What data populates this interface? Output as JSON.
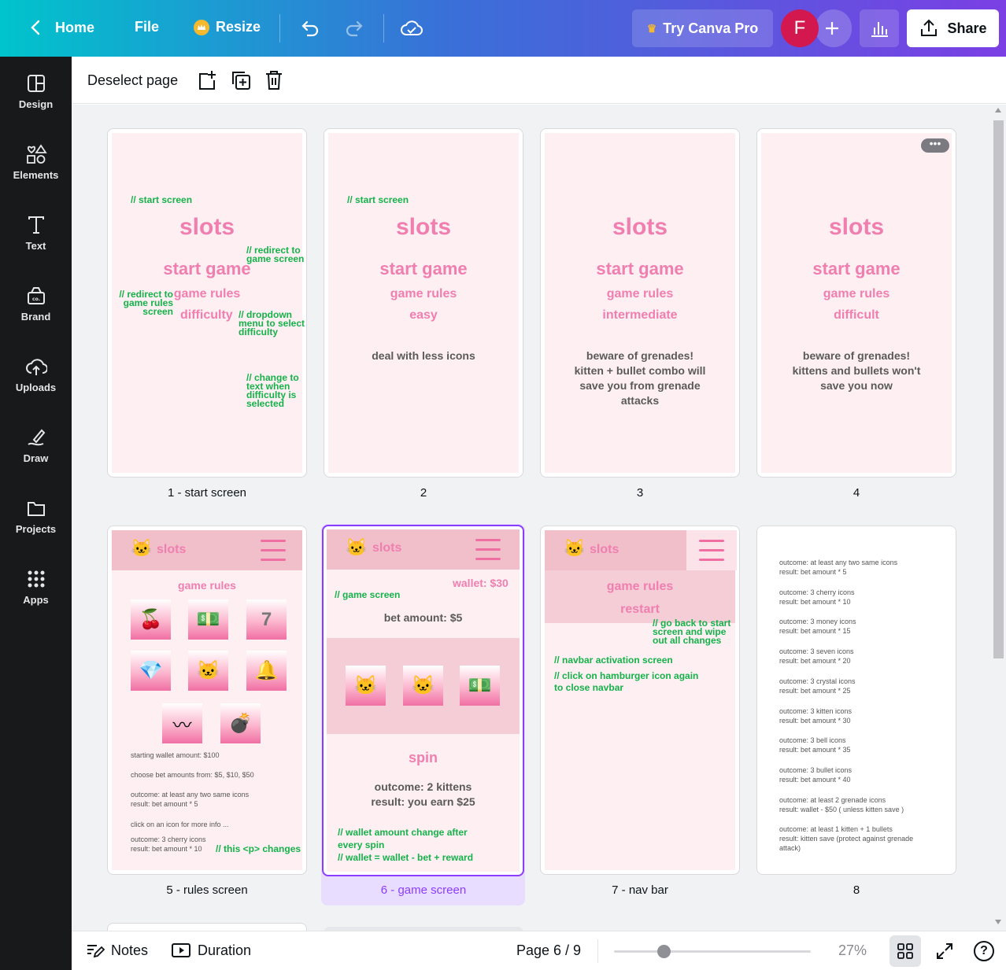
{
  "topbar": {
    "home": "Home",
    "file": "File",
    "resize": "Resize",
    "try_pro": "Try Canva Pro",
    "avatar": "F",
    "share": "Share"
  },
  "sidebar": {
    "items": [
      {
        "label": "Design",
        "icon": "design-icon"
      },
      {
        "label": "Elements",
        "icon": "elements-icon"
      },
      {
        "label": "Text",
        "icon": "text-icon"
      },
      {
        "label": "Brand",
        "icon": "brand-icon"
      },
      {
        "label": "Uploads",
        "icon": "uploads-icon"
      },
      {
        "label": "Draw",
        "icon": "draw-icon"
      },
      {
        "label": "Projects",
        "icon": "projects-icon"
      },
      {
        "label": "Apps",
        "icon": "apps-icon"
      }
    ]
  },
  "toolbar": {
    "deselect": "Deselect page"
  },
  "pages": {
    "p1": {
      "label": "1 - start screen",
      "c1": "// start screen",
      "title": "slots",
      "start": "start game",
      "rules": "game rules",
      "difficulty": "difficulty",
      "c2": "// redirect to game screen",
      "c3": "// redirect to game rules screen",
      "c4": "// dropdown menu to select difficulty",
      "c5": "// change to text when difficulty is selected"
    },
    "p2": {
      "label": "2",
      "c1": "// start screen",
      "title": "slots",
      "start": "start game",
      "rules": "game rules",
      "difficulty": "easy",
      "desc": "deal with less icons"
    },
    "p3": {
      "label": "3",
      "title": "slots",
      "start": "start game",
      "rules": "game rules",
      "difficulty": "intermediate",
      "desc1": "beware of grenades!",
      "desc2": "kitten + bullet combo will",
      "desc3": "save you from grenade",
      "desc4": "attacks"
    },
    "p4": {
      "label": "4",
      "title": "slots",
      "start": "start game",
      "rules": "game rules",
      "difficulty": "difficult",
      "desc1": "beware of grenades!",
      "desc2": "kittens and bullets won't",
      "desc3": "save you now"
    },
    "p5": {
      "label": "5 - rules screen",
      "brand": "slots",
      "heading": "game rules",
      "t1": "starting wallet amount: $100",
      "t2": "choose bet amounts from: $5, $10, $50",
      "t3a": "outcome: at least any two same icons",
      "t3b": "result: bet amount * 5",
      "t4": "click on an icon for more info ...",
      "t5a": "outcome: 3 cherry icons",
      "t5b": "result: bet amount * 10",
      "c1": "// this <p> changes"
    },
    "p6": {
      "label": "6 - game screen",
      "brand": "slots",
      "wallet": "wallet: $30",
      "c1": "// game screen",
      "bet": "bet amount: $5",
      "spin": "spin",
      "outcome": "outcome: 2 kittens",
      "result": "result: you earn $25",
      "c2": "// wallet amount change after",
      "c3": "every spin",
      "c4": "// wallet = wallet - bet + reward"
    },
    "p7": {
      "label": "7 - nav bar",
      "brand": "slots",
      "rules": "game rules",
      "restart": "restart",
      "c1": "// go back to start screen and wipe out all changes",
      "c2": "// navbar activation screen",
      "c3": "// click on hamburger icon again",
      "c4": "to close navbar"
    },
    "p8": {
      "label": "8",
      "rules": [
        [
          "outcome: at least any two same icons",
          "result: bet amount * 5"
        ],
        [
          "outcome: 3 cherry icons",
          "result: bet amount * 10"
        ],
        [
          "outcome: 3 money icons",
          "result: bet amount * 15"
        ],
        [
          "outcome: 3 seven icons",
          "result: bet amount * 20"
        ],
        [
          "outcome: 3 crystal icons",
          "result: bet amount * 25"
        ],
        [
          "outcome: 3 kitten icons",
          "result: bet amount * 30"
        ],
        [
          "outcome: 3 bell icons",
          "result: bet amount * 35"
        ],
        [
          "outcome: 3 bullet icons",
          "result: bet amount * 40"
        ],
        [
          "outcome: at least 2 grenade icons",
          "result: wallet - $50 ( unless kitten save )"
        ],
        [
          "outcome: at least 1 kitten + 1 bullets",
          "result: kitten save (protect against grenade",
          "attack)"
        ]
      ]
    }
  },
  "bottombar": {
    "notes": "Notes",
    "duration": "Duration",
    "page": "Page 6 / 9",
    "zoom": "27%",
    "zoom_level": 0.27
  },
  "colors": {
    "accent": "#8b3dff",
    "pink": "#f07fb0",
    "comment": "#15b24a"
  }
}
